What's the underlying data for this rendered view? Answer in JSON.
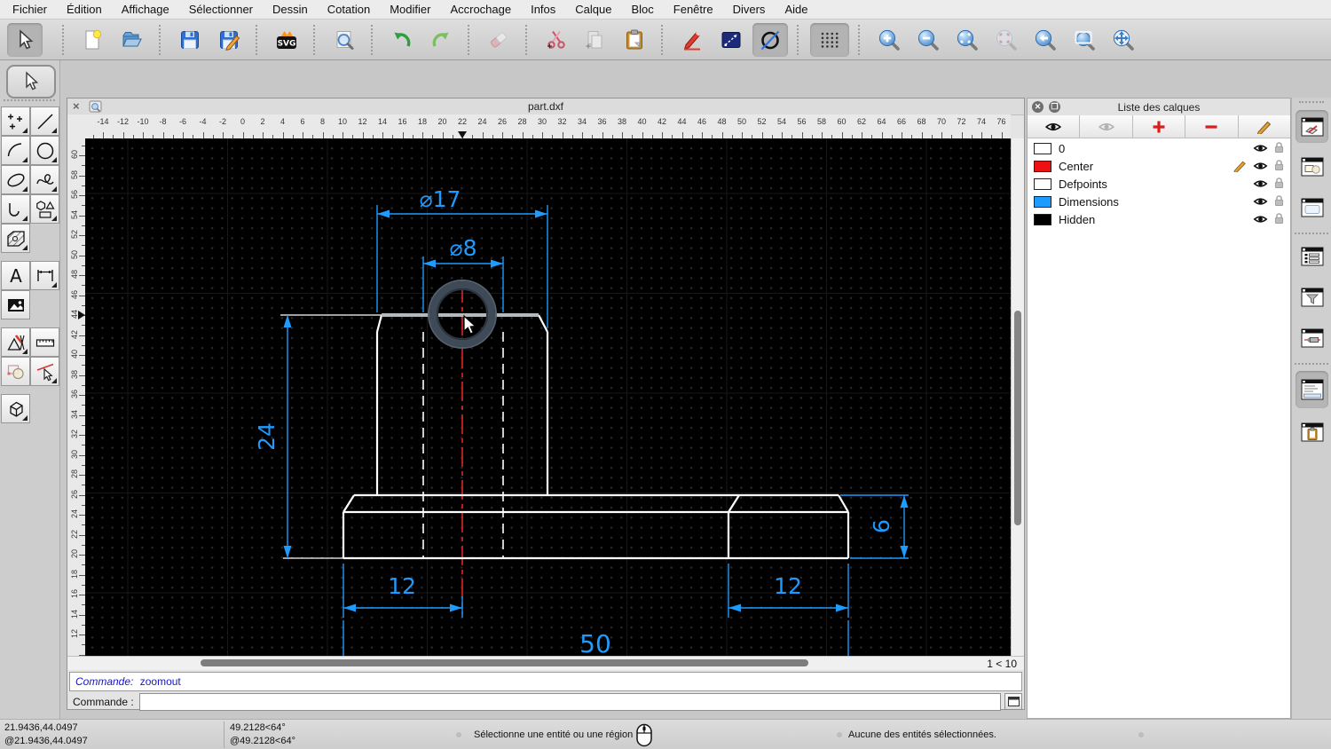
{
  "menu": {
    "items": [
      "Fichier",
      "Édition",
      "Affichage",
      "Sélectionner",
      "Dessin",
      "Cotation",
      "Modifier",
      "Accrochage",
      "Infos",
      "Calque",
      "Bloc",
      "Fenêtre",
      "Divers",
      "Aide"
    ]
  },
  "doc": {
    "title": "part.dxf",
    "zoom_indicator": "1 < 10"
  },
  "command": {
    "history_label": "Commande:",
    "history_value": "zoomout",
    "prompt_label": "Commande :",
    "input_value": ""
  },
  "status": {
    "abs_coord": "21.9436,44.0497",
    "rel_coord": "@21.9436,44.0497",
    "polar_abs": "49.2128<64°",
    "polar_rel": "@49.2128<64°",
    "hint": "Sélectionne une entité ou une région",
    "selection": "Aucune des entités sélectionnées."
  },
  "layers_panel": {
    "title": "Liste des calques",
    "items": [
      {
        "name": "0",
        "color": "#ffffff",
        "visible": true,
        "locked": false,
        "editing": false
      },
      {
        "name": "Center",
        "color": "#ee1111",
        "visible": true,
        "locked": false,
        "editing": true
      },
      {
        "name": "Defpoints",
        "color": "#ffffff",
        "visible": true,
        "locked": false,
        "editing": false
      },
      {
        "name": "Dimensions",
        "color": "#1e9bff",
        "visible": true,
        "locked": false,
        "editing": false
      },
      {
        "name": "Hidden",
        "color": "#000000",
        "visible": true,
        "locked": false,
        "editing": false
      }
    ]
  },
  "rulers": {
    "horizontal": {
      "labels": [
        -14,
        -12,
        -10,
        -8,
        -6,
        -4,
        -2,
        0,
        2,
        4,
        6,
        8,
        10,
        12,
        14,
        16,
        18,
        20,
        22,
        24,
        26,
        28,
        30,
        32,
        34,
        36,
        38,
        40,
        42,
        44,
        46,
        48,
        50,
        52,
        54,
        56,
        58,
        60,
        62,
        64,
        66,
        68,
        70,
        72,
        74,
        76
      ],
      "marker": 22
    },
    "vertical": {
      "labels": [
        60,
        58,
        56,
        54,
        52,
        50,
        48,
        46,
        44,
        42,
        40,
        38,
        36,
        34,
        32,
        30,
        28,
        26,
        24,
        22,
        20,
        18,
        16,
        14,
        12
      ],
      "marker": 44
    }
  },
  "drawing": {
    "dims": {
      "d17": "⌀17",
      "d8": "⌀8",
      "h24": "24",
      "w12_left": "12",
      "w12_right": "12",
      "h6": "6",
      "w50": "50"
    },
    "colors": {
      "dimension": "#1e9bff",
      "geometry": "#ffffff",
      "centerline": "#ff2a2a",
      "highlight": "#b4b9be",
      "background": "#000000"
    }
  },
  "icons": {
    "svg_export_label": "SVG",
    "text_tool_label": "A",
    "select_arrow": "cursor-arrow",
    "undo": "green-curved-arrow-left",
    "redo": "green-curved-arrow-right",
    "zoom_in": "magnifier-plus",
    "zoom_out": "magnifier-minus",
    "layer_visibility": "eye",
    "layer_lock": "padlock",
    "layer_edit": "pencil"
  }
}
